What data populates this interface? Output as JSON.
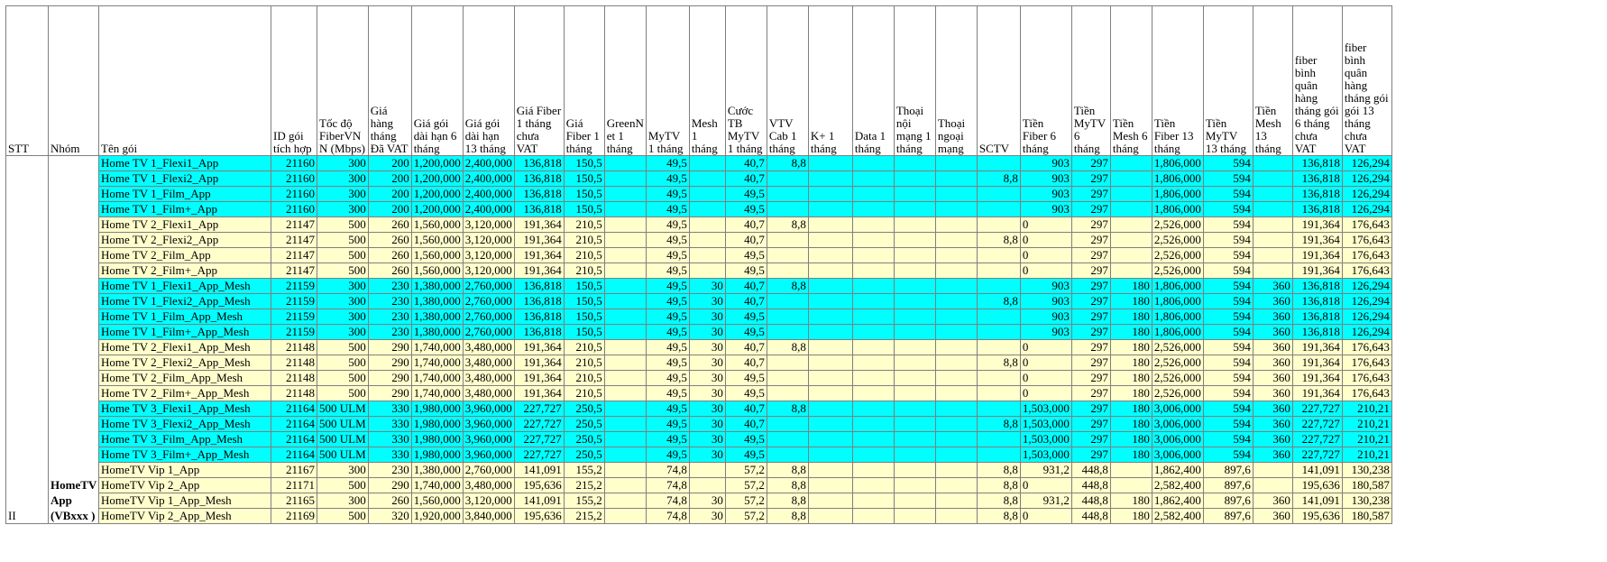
{
  "table": {
    "headers": [
      "STT",
      "Nhóm",
      "Tên gói",
      "ID gói tích hợp",
      "Tốc độ FiberVNN (Mbps)",
      "Giá hàng tháng Đã VAT",
      "Giá gói dài hạn 6 tháng",
      "Giá gói dài hạn 13 tháng",
      "Giá Fiber 1 tháng chưa VAT",
      "Giá Fiber 1 tháng",
      "GreenNet 1 tháng",
      "MyTV 1 tháng",
      "Mesh 1 tháng",
      "Cước TB MyTV 1 tháng",
      "VTV Cab 1 tháng",
      "K+ 1 tháng",
      "Data 1 tháng",
      "Thoại nội mạng 1 tháng",
      "Thoại ngoại mạng",
      "SCTV",
      "Tiền Fiber 6 tháng",
      "Tiền MyTV 6 tháng",
      "Tiền Mesh 6 tháng",
      "Tiền Fiber 13 tháng",
      "Tiền MyTV 13 tháng",
      "Tiền Mesh 13 tháng",
      "fiber bình quân hàng tháng gói 6 tháng chưa VAT",
      "fiber bình quân hàng tháng gói gói 13 tháng chưa VAT"
    ],
    "header_display": [
      "STT",
      "Nhóm",
      "Tên gói",
      "ID gói tích hợp",
      "Tốc độ FiberVN N (Mbps)",
      "Giá hàng tháng Đã VAT",
      "Giá gói dài hạn 6 tháng",
      "Giá gói dài hạn 13 tháng",
      "Giá Fiber 1 tháng chưa VAT",
      "Giá Fiber 1 tháng",
      "GreenN et 1 tháng",
      "MyTV 1 tháng",
      "Mesh 1 tháng",
      "Cước TB MyTV 1 tháng",
      "VTV Cab 1 tháng",
      "K+ 1 tháng",
      "Data 1 tháng",
      "Thoại nội mạng 1 tháng",
      "Thoại ngoại mạng",
      "SCTV",
      "Tiền Fiber 6 tháng",
      "Tiền MyTV 6 tháng",
      "Tiền Mesh 6 tháng",
      "Tiền Fiber 13 tháng",
      "Tiền MyTV 13 tháng",
      "Tiền Mesh 13 tháng",
      "fiber bình quân hàng tháng gói 6 tháng chưa VAT",
      "fiber bình quân hàng tháng gói gói 13 tháng chưa VAT"
    ],
    "stt_value": "II",
    "group_label": "HomeTV App (VBxxx )",
    "rows": [
      {
        "fill": "cyan",
        "cells": [
          "Home TV 1_Flexi1_App",
          "21160",
          "300",
          "200",
          "1,200,000",
          "2,400,000",
          "136,818",
          "150,5",
          "",
          "49,5",
          "",
          "40,7",
          "8,8",
          "",
          "",
          "",
          "",
          "",
          "903",
          "297",
          "",
          "1,806,000",
          "594",
          "",
          "136,818",
          "126,294"
        ]
      },
      {
        "fill": "cyan",
        "cells": [
          "Home TV 1_Flexi2_App",
          "21160",
          "300",
          "200",
          "1,200,000",
          "2,400,000",
          "136,818",
          "150,5",
          "",
          "49,5",
          "",
          "40,7",
          "",
          "",
          "",
          "",
          "",
          "8,8",
          "903",
          "297",
          "",
          "1,806,000",
          "594",
          "",
          "136,818",
          "126,294"
        ]
      },
      {
        "fill": "cyan",
        "cells": [
          "Home TV 1_Film_App",
          "21160",
          "300",
          "200",
          "1,200,000",
          "2,400,000",
          "136,818",
          "150,5",
          "",
          "49,5",
          "",
          "49,5",
          "",
          "",
          "",
          "",
          "",
          "",
          "903",
          "297",
          "",
          "1,806,000",
          "594",
          "",
          "136,818",
          "126,294"
        ]
      },
      {
        "fill": "cyan",
        "cells": [
          "Home TV 1_Film+_App",
          "21160",
          "300",
          "200",
          "1,200,000",
          "2,400,000",
          "136,818",
          "150,5",
          "",
          "49,5",
          "",
          "49,5",
          "",
          "",
          "",
          "",
          "",
          "",
          "903",
          "297",
          "",
          "1,806,000",
          "594",
          "",
          "136,818",
          "126,294"
        ]
      },
      {
        "fill": "yellow",
        "cells": [
          "Home TV 2_Flexi1_App",
          "21147",
          "500",
          "260",
          "1,560,000",
          "3,120,000",
          "191,364",
          "210,5",
          "",
          "49,5",
          "",
          "40,7",
          "8,8",
          "",
          "",
          "",
          "",
          "",
          "0",
          "297",
          "",
          "2,526,000",
          "594",
          "",
          "191,364",
          "176,643"
        ]
      },
      {
        "fill": "yellow",
        "cells": [
          "Home TV 2_Flexi2_App",
          "21147",
          "500",
          "260",
          "1,560,000",
          "3,120,000",
          "191,364",
          "210,5",
          "",
          "49,5",
          "",
          "40,7",
          "",
          "",
          "",
          "",
          "",
          "8,8",
          "0",
          "297",
          "",
          "2,526,000",
          "594",
          "",
          "191,364",
          "176,643"
        ]
      },
      {
        "fill": "yellow",
        "cells": [
          "Home TV 2_Film_App",
          "21147",
          "500",
          "260",
          "1,560,000",
          "3,120,000",
          "191,364",
          "210,5",
          "",
          "49,5",
          "",
          "49,5",
          "",
          "",
          "",
          "",
          "",
          "",
          "0",
          "297",
          "",
          "2,526,000",
          "594",
          "",
          "191,364",
          "176,643"
        ]
      },
      {
        "fill": "yellow",
        "cells": [
          "Home TV 2_Film+_App",
          "21147",
          "500",
          "260",
          "1,560,000",
          "3,120,000",
          "191,364",
          "210,5",
          "",
          "49,5",
          "",
          "49,5",
          "",
          "",
          "",
          "",
          "",
          "",
          "0",
          "297",
          "",
          "2,526,000",
          "594",
          "",
          "191,364",
          "176,643"
        ]
      },
      {
        "fill": "cyan",
        "cells": [
          "Home TV 1_Flexi1_App_Mesh",
          "21159",
          "300",
          "230",
          "1,380,000",
          "2,760,000",
          "136,818",
          "150,5",
          "",
          "49,5",
          "30",
          "40,7",
          "8,8",
          "",
          "",
          "",
          "",
          "",
          "903",
          "297",
          "180",
          "1,806,000",
          "594",
          "360",
          "136,818",
          "126,294"
        ]
      },
      {
        "fill": "cyan",
        "cells": [
          "Home TV 1_Flexi2_App_Mesh",
          "21159",
          "300",
          "230",
          "1,380,000",
          "2,760,000",
          "136,818",
          "150,5",
          "",
          "49,5",
          "30",
          "40,7",
          "",
          "",
          "",
          "",
          "",
          "8,8",
          "903",
          "297",
          "180",
          "1,806,000",
          "594",
          "360",
          "136,818",
          "126,294"
        ]
      },
      {
        "fill": "cyan",
        "cells": [
          "Home TV 1_Film_App_Mesh",
          "21159",
          "300",
          "230",
          "1,380,000",
          "2,760,000",
          "136,818",
          "150,5",
          "",
          "49,5",
          "30",
          "49,5",
          "",
          "",
          "",
          "",
          "",
          "",
          "903",
          "297",
          "180",
          "1,806,000",
          "594",
          "360",
          "136,818",
          "126,294"
        ]
      },
      {
        "fill": "cyan",
        "cells": [
          "Home TV 1_Film+_App_Mesh",
          "21159",
          "300",
          "230",
          "1,380,000",
          "2,760,000",
          "136,818",
          "150,5",
          "",
          "49,5",
          "30",
          "49,5",
          "",
          "",
          "",
          "",
          "",
          "",
          "903",
          "297",
          "180",
          "1,806,000",
          "594",
          "360",
          "136,818",
          "126,294"
        ]
      },
      {
        "fill": "yellow",
        "cells": [
          "Home TV 2_Flexi1_App_Mesh",
          "21148",
          "500",
          "290",
          "1,740,000",
          "3,480,000",
          "191,364",
          "210,5",
          "",
          "49,5",
          "30",
          "40,7",
          "8,8",
          "",
          "",
          "",
          "",
          "",
          "0",
          "297",
          "180",
          "2,526,000",
          "594",
          "360",
          "191,364",
          "176,643"
        ]
      },
      {
        "fill": "yellow",
        "cells": [
          "Home TV 2_Flexi2_App_Mesh",
          "21148",
          "500",
          "290",
          "1,740,000",
          "3,480,000",
          "191,364",
          "210,5",
          "",
          "49,5",
          "30",
          "40,7",
          "",
          "",
          "",
          "",
          "",
          "8,8",
          "0",
          "297",
          "180",
          "2,526,000",
          "594",
          "360",
          "191,364",
          "176,643"
        ]
      },
      {
        "fill": "yellow",
        "cells": [
          "Home TV 2_Film_App_Mesh",
          "21148",
          "500",
          "290",
          "1,740,000",
          "3,480,000",
          "191,364",
          "210,5",
          "",
          "49,5",
          "30",
          "49,5",
          "",
          "",
          "",
          "",
          "",
          "",
          "0",
          "297",
          "180",
          "2,526,000",
          "594",
          "360",
          "191,364",
          "176,643"
        ]
      },
      {
        "fill": "yellow",
        "cells": [
          "Home TV 2_Film+_App_Mesh",
          "21148",
          "500",
          "290",
          "1,740,000",
          "3,480,000",
          "191,364",
          "210,5",
          "",
          "49,5",
          "30",
          "49,5",
          "",
          "",
          "",
          "",
          "",
          "",
          "0",
          "297",
          "180",
          "2,526,000",
          "594",
          "360",
          "191,364",
          "176,643"
        ]
      },
      {
        "fill": "cyan",
        "cells": [
          "Home TV 3_Flexi1_App_Mesh",
          "21164",
          "500 ULM",
          "330",
          "1,980,000",
          "3,960,000",
          "227,727",
          "250,5",
          "",
          "49,5",
          "30",
          "40,7",
          "8,8",
          "",
          "",
          "",
          "",
          "",
          "1,503,000",
          "297",
          "180",
          "3,006,000",
          "594",
          "360",
          "227,727",
          "210,21"
        ]
      },
      {
        "fill": "cyan",
        "cells": [
          "Home TV 3_Flexi2_App_Mesh",
          "21164",
          "500 ULM",
          "330",
          "1,980,000",
          "3,960,000",
          "227,727",
          "250,5",
          "",
          "49,5",
          "30",
          "40,7",
          "",
          "",
          "",
          "",
          "",
          "8,8",
          "1,503,000",
          "297",
          "180",
          "3,006,000",
          "594",
          "360",
          "227,727",
          "210,21"
        ]
      },
      {
        "fill": "cyan",
        "cells": [
          "Home TV 3_Film_App_Mesh",
          "21164",
          "500 ULM",
          "330",
          "1,980,000",
          "3,960,000",
          "227,727",
          "250,5",
          "",
          "49,5",
          "30",
          "49,5",
          "",
          "",
          "",
          "",
          "",
          "",
          "1,503,000",
          "297",
          "180",
          "3,006,000",
          "594",
          "360",
          "227,727",
          "210,21"
        ]
      },
      {
        "fill": "cyan",
        "cells": [
          "Home TV 3_Film+_App_Mesh",
          "21164",
          "500 ULM",
          "330",
          "1,980,000",
          "3,960,000",
          "227,727",
          "250,5",
          "",
          "49,5",
          "30",
          "49,5",
          "",
          "",
          "",
          "",
          "",
          "",
          "1,503,000",
          "297",
          "180",
          "3,006,000",
          "594",
          "360",
          "227,727",
          "210,21"
        ]
      },
      {
        "fill": "yellow",
        "cells": [
          "HomeTV Vip 1_App",
          "21167",
          "300",
          "230",
          "1,380,000",
          "2,760,000",
          "141,091",
          "155,2",
          "",
          "74,8",
          "",
          "57,2",
          "8,8",
          "",
          "",
          "",
          "",
          "8,8",
          "931,2",
          "448,8",
          "",
          "1,862,400",
          "897,6",
          "",
          "141,091",
          "130,238"
        ]
      },
      {
        "fill": "yellow",
        "cells": [
          "HomeTV Vip 2_App",
          "21171",
          "500",
          "290",
          "1,740,000",
          "3,480,000",
          "195,636",
          "215,2",
          "",
          "74,8",
          "",
          "57,2",
          "8,8",
          "",
          "",
          "",
          "",
          "8,8",
          "0",
          "448,8",
          "",
          "2,582,400",
          "897,6",
          "",
          "195,636",
          "180,587"
        ]
      },
      {
        "fill": "yellow",
        "cells": [
          "HomeTV Vip 1_App_Mesh",
          "21165",
          "300",
          "260",
          "1,560,000",
          "3,120,000",
          "141,091",
          "155,2",
          "",
          "74,8",
          "30",
          "57,2",
          "8,8",
          "",
          "",
          "",
          "",
          "8,8",
          "931,2",
          "448,8",
          "180",
          "1,862,400",
          "897,6",
          "360",
          "141,091",
          "130,238"
        ]
      },
      {
        "fill": "yellow",
        "cells": [
          "HomeTV Vip 2_App_Mesh",
          "21169",
          "500",
          "320",
          "1,920,000",
          "3,840,000",
          "195,636",
          "215,2",
          "",
          "74,8",
          "30",
          "57,2",
          "8,8",
          "",
          "",
          "",
          "",
          "8,8",
          "0",
          "448,8",
          "180",
          "2,582,400",
          "897,6",
          "360",
          "195,636",
          "180,587"
        ]
      }
    ],
    "colors": {
      "cyan": "#00ffff",
      "yellow": "#ffffcc",
      "grid": "#7f7f7f"
    }
  }
}
